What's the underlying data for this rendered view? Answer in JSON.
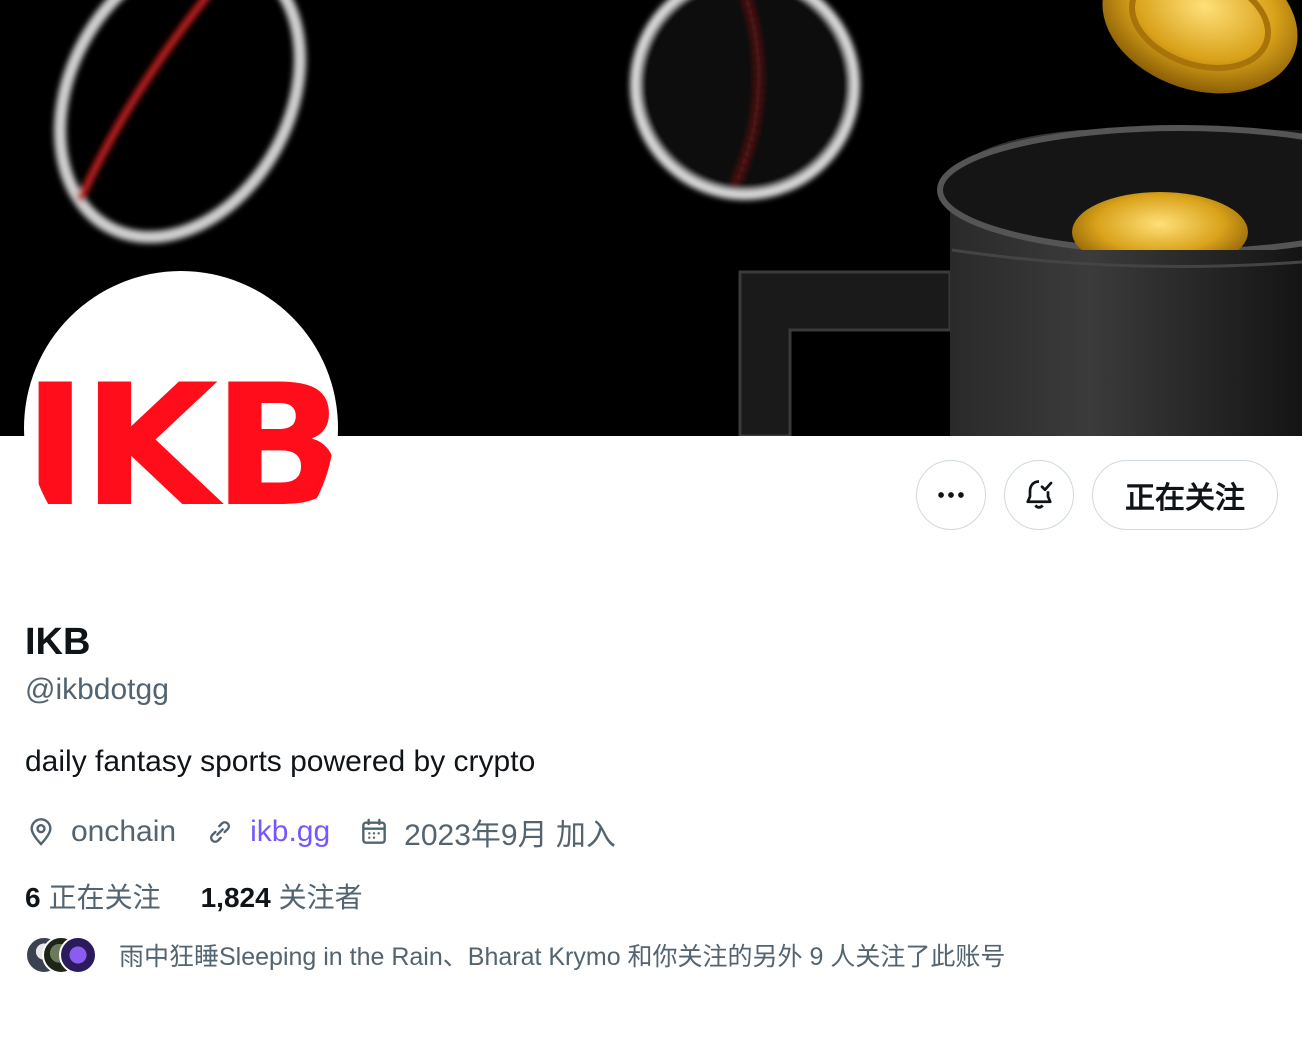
{
  "profile": {
    "avatar_logo_text": "IKB",
    "display_name": "IKB",
    "handle": "@ikbdotgg",
    "bio": "daily fantasy sports powered by crypto",
    "location": "onchain",
    "website": "ikb.gg",
    "joined": "2023年9月 加入"
  },
  "actions": {
    "more_icon": "more-horizontal-icon",
    "notify_icon": "bell-check-icon",
    "follow_label": "正在关注"
  },
  "stats": {
    "following_count": "6",
    "following_label": "正在关注",
    "followers_count": "1,824",
    "followers_label": "关注者"
  },
  "followed_by": {
    "text": "雨中狂睡Sleeping in the Rain、Bharat Krymo 和你关注的另外 9 人关注了此账号"
  },
  "colors": {
    "accent_link": "#7856ff",
    "logo_red": "#ff0d1a",
    "secondary_text": "#536471",
    "border": "#cfd9de"
  }
}
